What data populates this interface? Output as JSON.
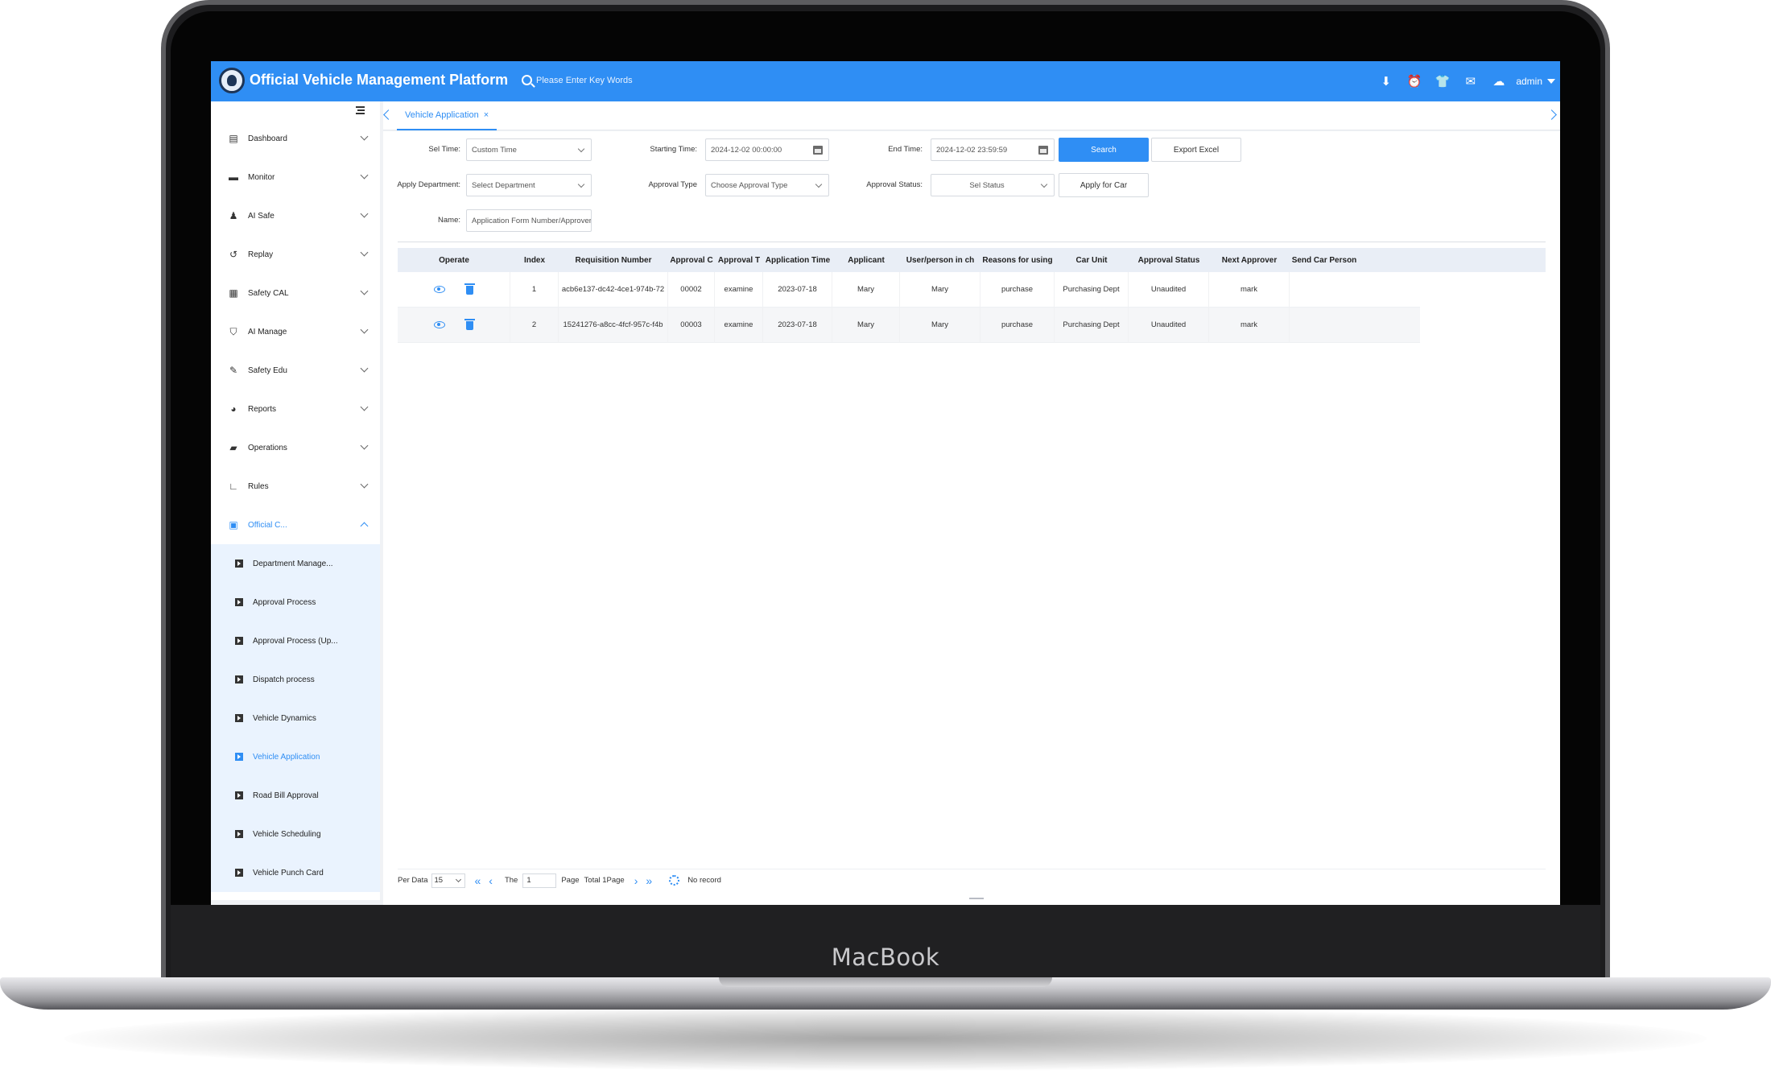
{
  "device": {
    "brand": "MacBook"
  },
  "header": {
    "title": "Official Vehicle Management Platform",
    "search_placeholder": "Please Enter Key Words",
    "icons": [
      "download-icon",
      "alarm-icon",
      "shirt-icon",
      "mail-icon",
      "cloud-icon"
    ],
    "user": "admin"
  },
  "sidebar": {
    "items": [
      {
        "label": "Dashboard",
        "icon": "dashboard-icon",
        "glyph": "▤"
      },
      {
        "label": "Monitor",
        "icon": "car-icon",
        "glyph": "▬"
      },
      {
        "label": "AI Safe",
        "icon": "user-shield-icon",
        "glyph": "♟"
      },
      {
        "label": "Replay",
        "icon": "replay-icon",
        "glyph": "↺"
      },
      {
        "label": "Safety CAL",
        "icon": "database-icon",
        "glyph": "▦"
      },
      {
        "label": "AI Manage",
        "icon": "shield-icon",
        "glyph": "⛉"
      },
      {
        "label": "Safety Edu",
        "icon": "graduation-cap-icon",
        "glyph": "✎"
      },
      {
        "label": "Reports",
        "icon": "pie-chart-icon",
        "glyph": "◕"
      },
      {
        "label": "Operations",
        "icon": "car-front-icon",
        "glyph": "▰"
      },
      {
        "label": "Rules",
        "icon": "boot-icon",
        "glyph": "∟"
      },
      {
        "label": "Official C...",
        "icon": "document-icon",
        "glyph": "▣",
        "open": true
      }
    ],
    "submenu": [
      {
        "label": "Department Manage..."
      },
      {
        "label": "Approval Process"
      },
      {
        "label": "Approval Process (Up..."
      },
      {
        "label": "Dispatch process"
      },
      {
        "label": "Vehicle Dynamics"
      },
      {
        "label": "Vehicle Application",
        "active": true
      },
      {
        "label": "Road Bill Approval"
      },
      {
        "label": "Vehicle Scheduling"
      },
      {
        "label": "Vehicle Punch Card"
      }
    ]
  },
  "tabs": [
    {
      "label": "Vehicle Application",
      "close": "×"
    }
  ],
  "filters": {
    "sel_time_label": "Sel Time:",
    "sel_time_value": "Custom Time",
    "start_label": "Starting Time:",
    "start_value": "2024-12-02 00:00:00",
    "end_label": "End Time:",
    "end_value": "2024-12-02 23:59:59",
    "search_button": "Search",
    "export_button": "Export Excel",
    "dept_label": "Apply Department:",
    "dept_placeholder": "Select Department",
    "approval_type_label": "Approval Type",
    "approval_type_placeholder": "Choose Approval Type",
    "approval_status_label": "Approval Status:",
    "approval_status_placeholder": "Sel Status",
    "apply_button": "Apply for Car",
    "name_label": "Name:",
    "name_placeholder": "Application Form Number/Approver"
  },
  "table": {
    "columns": [
      "Operate",
      "Index",
      "Requisition Number",
      "Approval C",
      "Approval T",
      "Application Time",
      "Applicant",
      "User/person in ch",
      "Reasons for using",
      "Car Unit",
      "Approval Status",
      "Next Approver",
      "Send Car Person"
    ],
    "rows": [
      {
        "index": "1",
        "requisition": "acb6e137-dc42-4ce1-974b-72",
        "approval_code": "00002",
        "approval_type": "examine",
        "time": "2023-07-18",
        "applicant": "Mary",
        "user": "Mary",
        "reason": "purchase",
        "car_unit": "Purchasing Dept",
        "status": "Unaudited",
        "next_approver": "mark",
        "send_car": ""
      },
      {
        "index": "2",
        "requisition": "15241276-a8cc-4fcf-957c-f4b",
        "approval_code": "00003",
        "approval_type": "examine",
        "time": "2023-07-18",
        "applicant": "Mary",
        "user": "Mary",
        "reason": "purchase",
        "car_unit": "Purchasing Dept",
        "status": "Unaudited",
        "next_approver": "mark",
        "send_car": ""
      }
    ]
  },
  "pager": {
    "per_data_label": "Per Data",
    "per_data_value": "15",
    "the_label": "The",
    "page_value": "1",
    "page_label": "Page",
    "total_label": "Total 1Page",
    "status": "No record"
  },
  "colors": {
    "accent": "#2f8ef4",
    "submenu_bg": "#eaf3fe",
    "header_bg": "#e9eef6"
  }
}
